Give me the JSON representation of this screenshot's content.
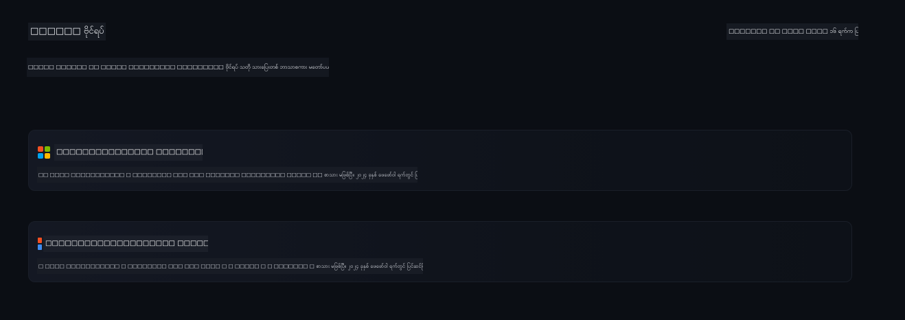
{
  "header": {
    "title": "□□□□□□ ဗိုင်ရပ်",
    "updated": "□□□□□□□ □□ □□□□ □□□□ ၁၆ ရက်က ပြင်ဆင်ပြီး"
  },
  "intro": {
    "description": "□□□□□ □□□□□□ □□ □□□□□ □□□□□□□□□ □□□□□□□□□ ဗိုင်ရပ် သတို သားပြေးတစ် ဘာသာစကား မတော်ပယ် များ မျိုးဆက်ပြောသည်။"
  },
  "cards": [
    {
      "title": "□□□□□□□□□□□□□□□ □□□□□□□□□□□□□□",
      "description": "□□ □□□□ □□□□□□□□□□□ □ □□□□□□□□ □□□ □□□ □□□□□□□ □□□□□□□□□ □□□□□ □□ စာသား မဖြစ်ပြီ။ ၂၀၂၄ ခုနှစ် ဖေဖော်ဝါ ရက်တွင် ပြင်ဆင်ပြီး □□□□□□□□□ □□□□",
      "logo_colors": [
        "#f25022",
        "#7fba00",
        "#00a4ef",
        "#ffb900"
      ]
    },
    {
      "title": "□□□□□□□□□□□□□□□□□□□□ □□□□□□□□□□□□□□□□□□",
      "description": "□ □□□□ □□□□□□□□□□□ □ □□□□□□□□ □□□ □□□ □□□□ □ □ □□□□□ □ □ □□□□□□□ □ စာသား မဖြစ်ပြီ။ ၂၀၂၄ ခုနှစ် ဖေဖော်ဝါ ရက်တွင် ပြင်ဆင်ပြီး □ □□□□ □ □ □□□□□",
      "logo_colors": [
        "#f25022",
        "#3f8cf0"
      ]
    }
  ]
}
